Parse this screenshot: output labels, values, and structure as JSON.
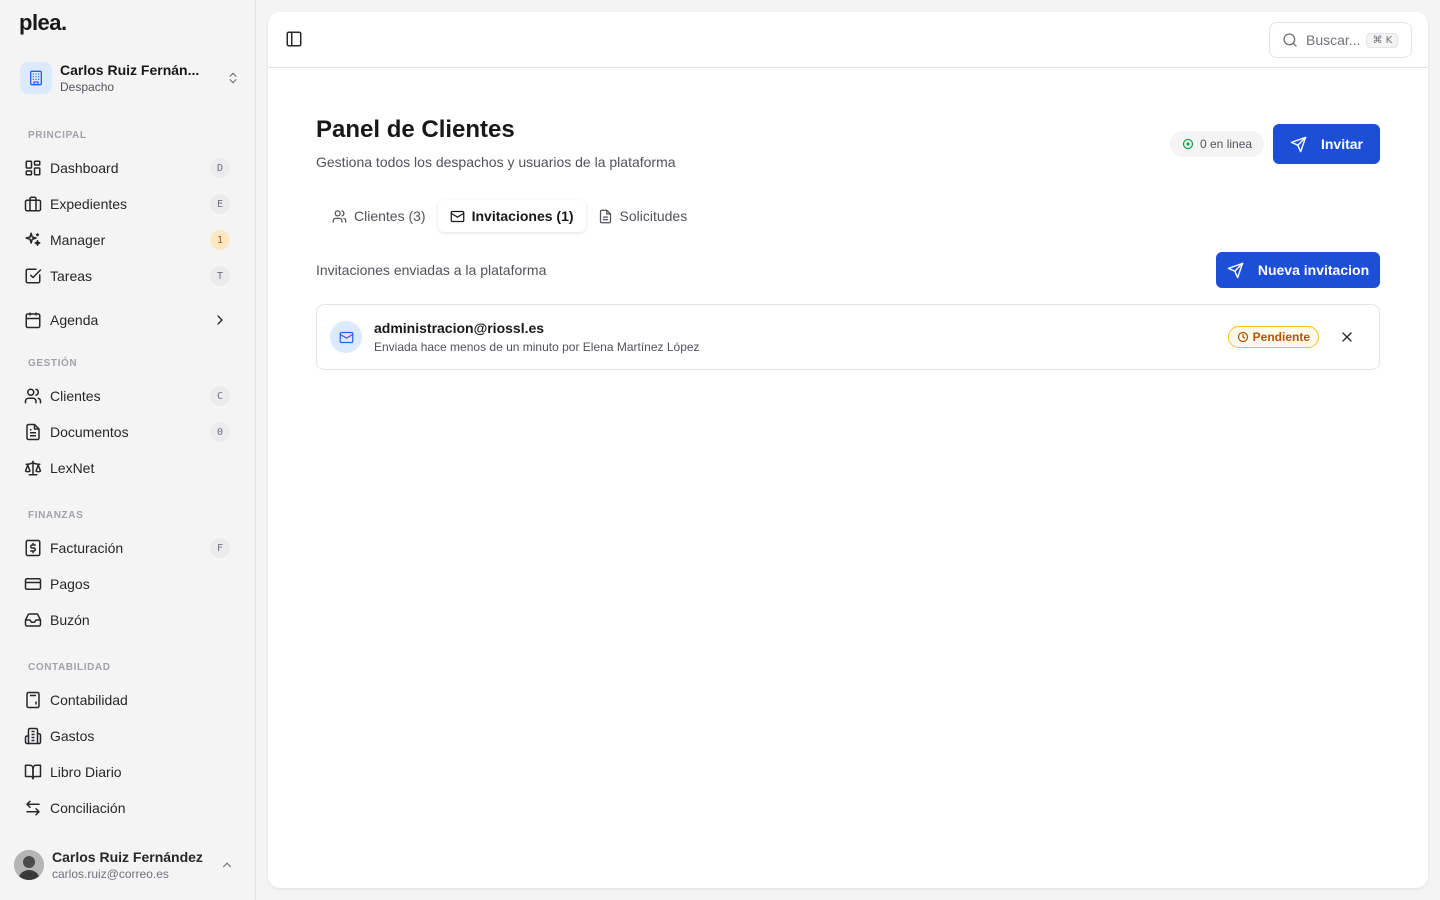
{
  "app": {
    "logo": "plea."
  },
  "workspace": {
    "name": "Carlos Ruiz Fernán...",
    "role": "Despacho"
  },
  "sidebar": {
    "sections": {
      "principal": "PRINCIPAL",
      "gestion": "GESTIÓN",
      "finanzas": "FINANZAS",
      "contabilidad": "CONTABILIDAD"
    },
    "items": {
      "dashboard": {
        "label": "Dashboard",
        "kbd": "D"
      },
      "expedientes": {
        "label": "Expedientes",
        "kbd": "E"
      },
      "manager": {
        "label": "Manager",
        "badge": "1"
      },
      "tareas": {
        "label": "Tareas",
        "kbd": "T"
      },
      "agenda": {
        "label": "Agenda"
      },
      "clientes": {
        "label": "Clientes",
        "kbd": "C"
      },
      "documentos": {
        "label": "Documentos",
        "kbd": "0"
      },
      "lexnet": {
        "label": "LexNet"
      },
      "facturacion": {
        "label": "Facturación",
        "kbd": "F"
      },
      "pagos": {
        "label": "Pagos"
      },
      "buzon": {
        "label": "Buzón"
      },
      "contabilidad": {
        "label": "Contabilidad"
      },
      "gastos": {
        "label": "Gastos"
      },
      "libro": {
        "label": "Libro Diario"
      },
      "conciliacion": {
        "label": "Conciliación"
      }
    }
  },
  "user": {
    "name": "Carlos Ruiz Fernández",
    "email": "carlos.ruiz@correo.es"
  },
  "topbar": {
    "search_placeholder": "Buscar...",
    "search_kbd": "⌘ K"
  },
  "page": {
    "title": "Panel de Clientes",
    "subtitle": "Gestiona todos los despachos y usuarios de la plataforma",
    "online": "0 en linea",
    "invite_button": "Invitar"
  },
  "tabs": {
    "clientes": "Clientes (3)",
    "invitaciones": "Invitaciones (1)",
    "solicitudes": "Solicitudes"
  },
  "invitations": {
    "description": "Invitaciones enviadas a la plataforma",
    "new_button": "Nueva invitacion",
    "item": {
      "email": "administracion@riossl.es",
      "meta": "Enviada hace menos de un minuto por Elena Martínez López",
      "status": "Pendiente"
    }
  },
  "colors": {
    "accent": "#1d4ed8",
    "pending": "#b45309",
    "online": "#16a34a"
  }
}
